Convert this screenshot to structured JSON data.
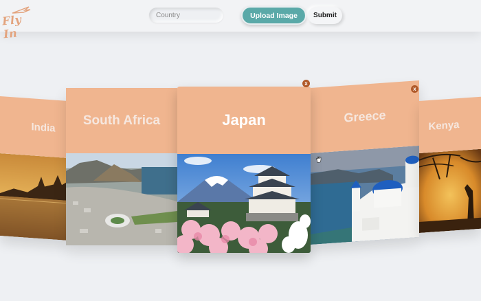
{
  "header": {
    "logo_text": "Fly In",
    "search": {
      "placeholder": "Country",
      "value": ""
    },
    "upload_label": "Upload Image",
    "submit_label": "Submit"
  },
  "cards": [
    {
      "title": "India"
    },
    {
      "title": "South Africa"
    },
    {
      "title": "Japan"
    },
    {
      "title": "Greece"
    },
    {
      "title": "Kenya"
    }
  ],
  "close_label": "x",
  "colors": {
    "card_header": "#f0b58f",
    "upload_button": "#5aa9a8",
    "close_badge": "#b05a2a",
    "logo": "#e3a37d"
  },
  "icons": [
    "plane-icon",
    "close-icon",
    "hand-cursor-icon"
  ]
}
